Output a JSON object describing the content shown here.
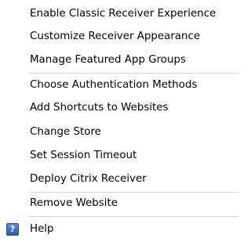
{
  "menu": {
    "items": [
      {
        "label": "Enable Classic Receiver Experience"
      },
      {
        "label": "Customize Receiver Appearance"
      },
      {
        "label": "Manage Featured App Groups"
      },
      {
        "label": "Choose Authentication Methods"
      },
      {
        "label": "Add Shortcuts to Websites"
      },
      {
        "label": "Change Store"
      },
      {
        "label": "Set Session Timeout"
      },
      {
        "label": "Deploy Citrix Receiver"
      },
      {
        "label": "Remove Website"
      },
      {
        "label": "Help",
        "icon": "help-icon",
        "icon_glyph": "?"
      }
    ]
  }
}
